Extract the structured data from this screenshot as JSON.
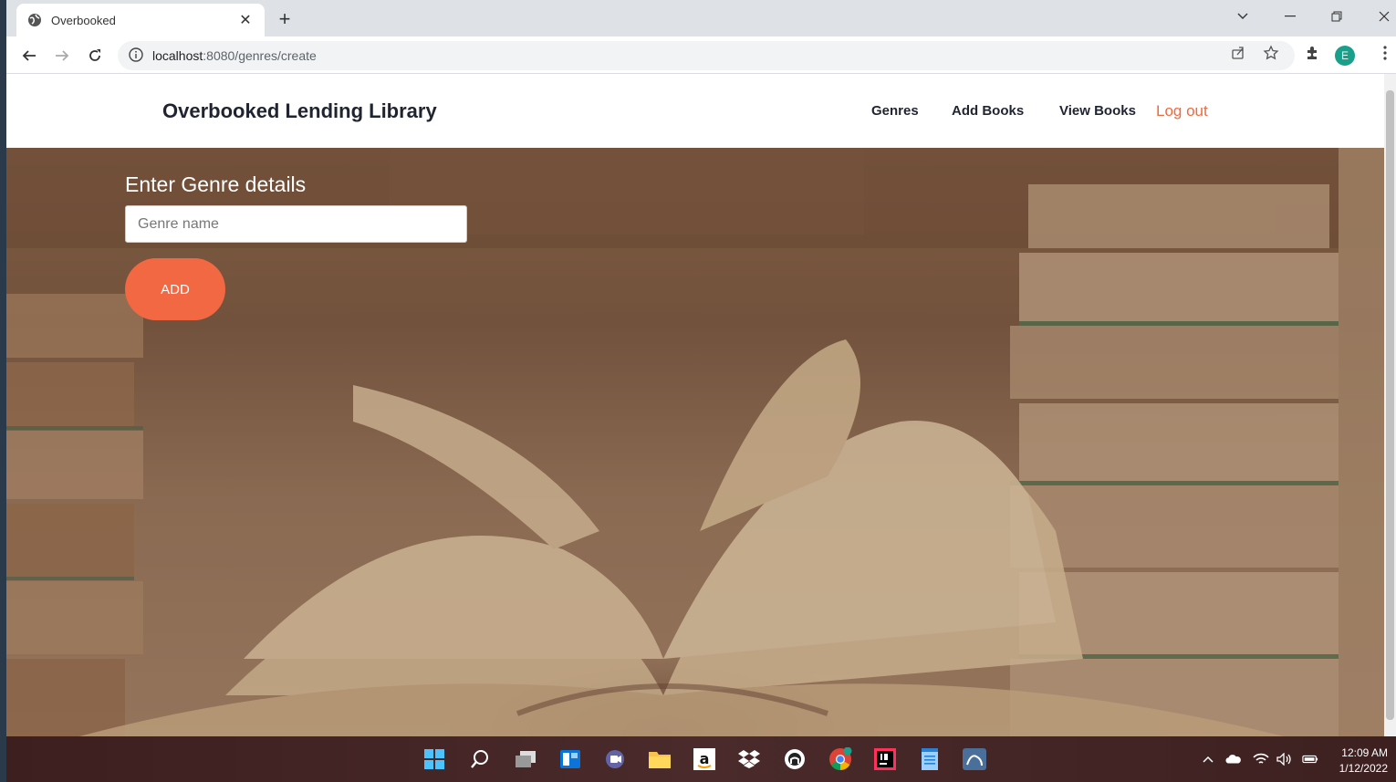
{
  "browser": {
    "tab": {
      "title": "Overbooked",
      "close": "✕"
    },
    "new_tab": "+",
    "address": {
      "host": "localhost",
      "path": ":8080/genres/create"
    },
    "profile_initial": "E"
  },
  "navbar": {
    "brand": "Overbooked Lending Library",
    "links": [
      "Genres",
      "Add Books",
      "View Books"
    ],
    "logout": "Log out"
  },
  "form": {
    "title": "Enter Genre details",
    "input_placeholder": "Genre name",
    "input_value": "",
    "button_label": "ADD"
  },
  "taskbar": {
    "time": "12:09 AM",
    "date": "1/12/2022"
  },
  "colors": {
    "accent": "#f26843",
    "logout": "#f06a3e",
    "navbar_text": "#1f2430"
  }
}
